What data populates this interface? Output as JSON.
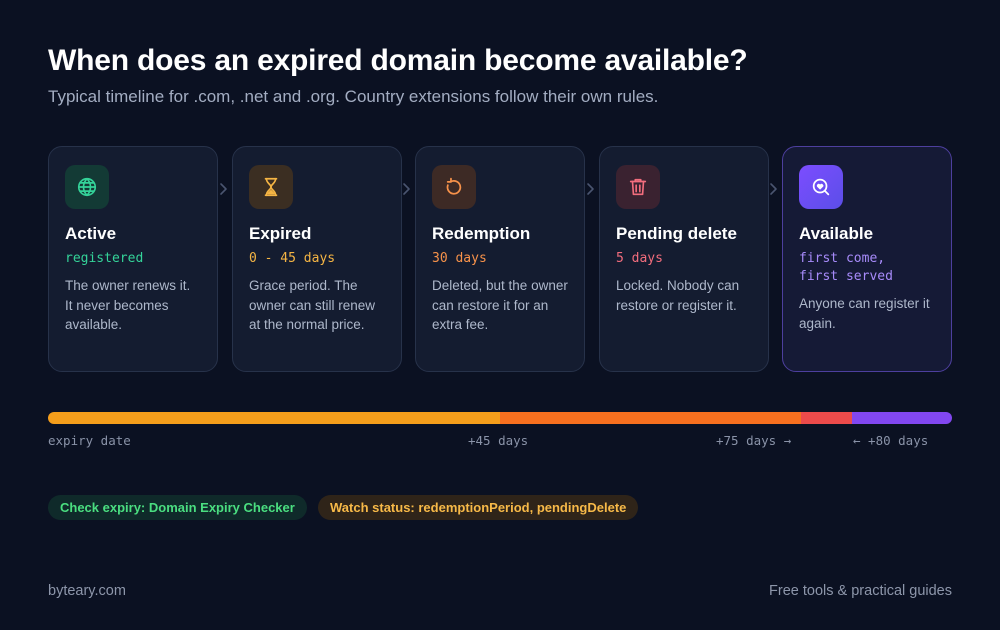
{
  "header": {
    "title": "When does an expired domain become available?",
    "subtitle": "Typical timeline for .com, .net and .org. Country extensions follow their own rules."
  },
  "stages": [
    {
      "icon": "globe-icon",
      "title": "Active",
      "duration": "registered",
      "description": "The owner renews it. It never becomes available.",
      "accent": "#34d399",
      "icon_bg": "#133a35"
    },
    {
      "icon": "hourglass-icon",
      "title": "Expired",
      "duration": "0 - 45 days",
      "description": "Grace period. The owner can still renew at the normal price.",
      "accent": "#f5b544",
      "icon_bg": "#3b2e22"
    },
    {
      "icon": "restore-icon",
      "title": "Redemption",
      "duration": "30 days",
      "description": "Deleted, but the owner can restore it for an extra fee.",
      "accent": "#f7924a",
      "icon_bg": "#3d2a25"
    },
    {
      "icon": "trash-icon",
      "title": "Pending delete",
      "duration": "5 days",
      "description": "Locked. Nobody can restore or register it.",
      "accent": "#f26d7d",
      "icon_bg": "#3a2230"
    },
    {
      "icon": "search-heart-icon",
      "title": "Available",
      "duration": "first come, first served",
      "description": "Anyone can register it again.",
      "accent": "#a78bfa",
      "icon_bg": "#6d4df0"
    }
  ],
  "timeline": {
    "segments": [
      {
        "stage": "Expired",
        "days": 45,
        "color": "#f59e1b"
      },
      {
        "stage": "Redemption",
        "days": 30,
        "color": "#f7701f"
      },
      {
        "stage": "Pending delete",
        "days": 5,
        "color": "#ec4b4b"
      },
      {
        "stage": "Available",
        "days": 0,
        "color": "#8247f0"
      }
    ],
    "labels": {
      "start": "expiry date",
      "mid": "+45 days",
      "redemption_end": "+75 days →",
      "delete_end": "← +80 days"
    }
  },
  "pills": [
    {
      "text": "Check expiry: Domain Expiry Checker",
      "color": "#4ade80",
      "bg": "#0f2a2a"
    },
    {
      "text": "Watch status: redemptionPeriod, pendingDelete",
      "color": "#f7b948",
      "bg": "#2f2419"
    }
  ],
  "footer": {
    "site": "byteary.com",
    "tagline": "Free tools & practical guides"
  }
}
